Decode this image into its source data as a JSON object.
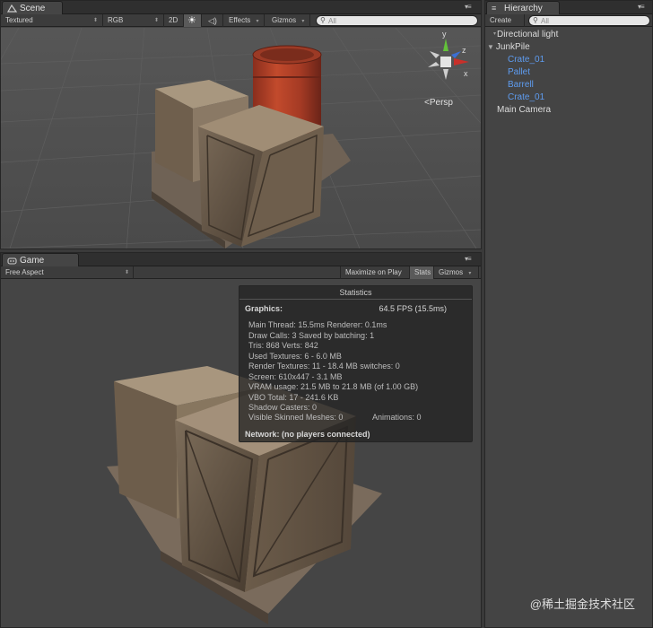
{
  "scene": {
    "tab": "Scene",
    "toolbar": {
      "draw_mode": "Textured",
      "render_mode": "RGB",
      "mode_2d": "2D",
      "effects": "Effects",
      "gizmos": "Gizmos",
      "search_placeholder": "All"
    },
    "gizmo": {
      "axis_y": "y",
      "axis_x": "x",
      "axis_z": "z",
      "projection": "Persp"
    },
    "colors": {
      "axis_y": "#63c13a",
      "axis_x": "#c8302a",
      "axis_z": "#3c6fd4"
    }
  },
  "game": {
    "tab": "Game",
    "toolbar": {
      "aspect": "Free Aspect",
      "maximize_on_play": "Maximize on Play",
      "stats": "Stats",
      "gizmos": "Gizmos"
    }
  },
  "hierarchy": {
    "tab": "Hierarchy",
    "create": "Create",
    "search_placeholder": "All",
    "items": [
      {
        "label": "Directional light",
        "indent": 0,
        "child": false
      },
      {
        "label": "JunkPile",
        "indent": 0,
        "child": false,
        "expanded": true
      },
      {
        "label": "Crate_01",
        "indent": 1,
        "child": true
      },
      {
        "label": "Pallet",
        "indent": 1,
        "child": true
      },
      {
        "label": "Barrell",
        "indent": 1,
        "child": true
      },
      {
        "label": "Crate_01",
        "indent": 1,
        "child": true
      },
      {
        "label": "Main Camera",
        "indent": 0,
        "child": false
      }
    ],
    "colors": {
      "child_text": "#5e9cf0",
      "text": "#dcdcdc"
    }
  },
  "statistics": {
    "title": "Statistics",
    "graphics_label": "Graphics:",
    "fps": "64.5 FPS (15.5ms)",
    "lines": [
      "Main Thread: 15.5ms  Renderer: 0.1ms",
      "Draw Calls: 3  Saved by batching: 1",
      "Tris: 868   Verts: 842",
      "Used Textures: 6 - 6.0 MB",
      "Render Textures: 11 - 18.4 MB  switches: 0",
      "Screen: 610x447 - 3.1 MB",
      "VRAM usage: 21.5 MB to 21.8 MB (of 1.00 GB)",
      "VBO Total: 17 - 241.6 KB",
      "Shadow Casters: 0"
    ],
    "skinned": "Visible Skinned Meshes: 0",
    "animations": "Animations: 0",
    "network": "Network: (no players connected)"
  },
  "watermark": "@稀土掘金技术社区"
}
